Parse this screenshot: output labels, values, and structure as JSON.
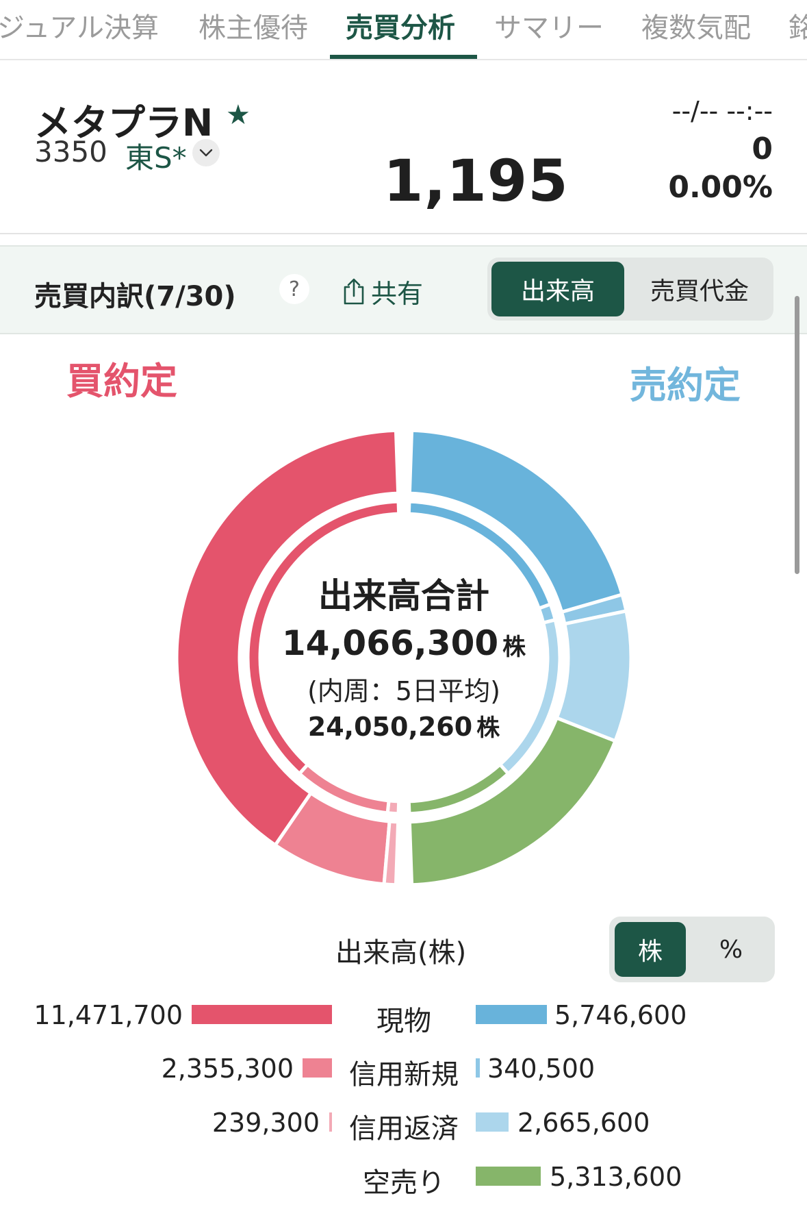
{
  "tabs": [
    {
      "label": "ジュアル決算",
      "active": false
    },
    {
      "label": "株主優待",
      "active": false
    },
    {
      "label": "売買分析",
      "active": true
    },
    {
      "label": "サマリー",
      "active": false
    },
    {
      "label": "複数気配",
      "active": false
    },
    {
      "label": "銘",
      "active": false
    }
  ],
  "stock": {
    "name": "メタプラN",
    "star": "★",
    "code": "3350",
    "market": "東S*",
    "price": "1,195",
    "timestamp": "--/-- --:--",
    "change": "0",
    "change_pct": "0.00%"
  },
  "section": {
    "title": "売買内訳(7/30)",
    "help": "?",
    "share": "共有",
    "segment": [
      {
        "label": "出来高",
        "active": true
      },
      {
        "label": "売買代金",
        "active": false
      }
    ]
  },
  "donut": {
    "buy_label": "買約定",
    "sell_label": "売約定",
    "center_title": "出来高合計",
    "center_total": "14,066,300",
    "center_unit": "株",
    "center_sub": "(内周：5日平均)",
    "center_avg": "24,050,260",
    "colors": {
      "buy_cash": "#e4546c",
      "buy_margin_new": "#ee8292",
      "buy_margin_repay": "#f3aab6",
      "sell_cash": "#68b3db",
      "sell_margin_new": "#8ec7e6",
      "sell_margin_repay": "#acd6ec",
      "short": "#86b56a"
    }
  },
  "legend": {
    "title": "出来高(株)",
    "unit_toggle": [
      {
        "label": "株",
        "active": true
      },
      {
        "label": "%",
        "active": false
      }
    ],
    "rows": [
      {
        "label": "現物",
        "buy": "11,471,700",
        "sell": "5,746,600"
      },
      {
        "label": "信用新規",
        "buy": "2,355,300",
        "sell": "340,500"
      },
      {
        "label": "信用返済",
        "buy": "239,300",
        "sell": "2,665,600"
      },
      {
        "label": "空売り",
        "buy": "",
        "sell": "5,313,600"
      }
    ]
  },
  "chart_data": {
    "type": "pie",
    "title": "出来高合計",
    "total": 14066300,
    "inner_ring_note": "(内周：5日平均)",
    "inner_ring_total": 24050260,
    "categories": [
      "現物",
      "信用新規",
      "信用返済",
      "空売り"
    ],
    "series": [
      {
        "name": "買約定",
        "values": [
          11471700,
          2355300,
          239300,
          null
        ]
      },
      {
        "name": "売約定",
        "values": [
          5746600,
          340500,
          2665600,
          5313600
        ]
      }
    ]
  }
}
